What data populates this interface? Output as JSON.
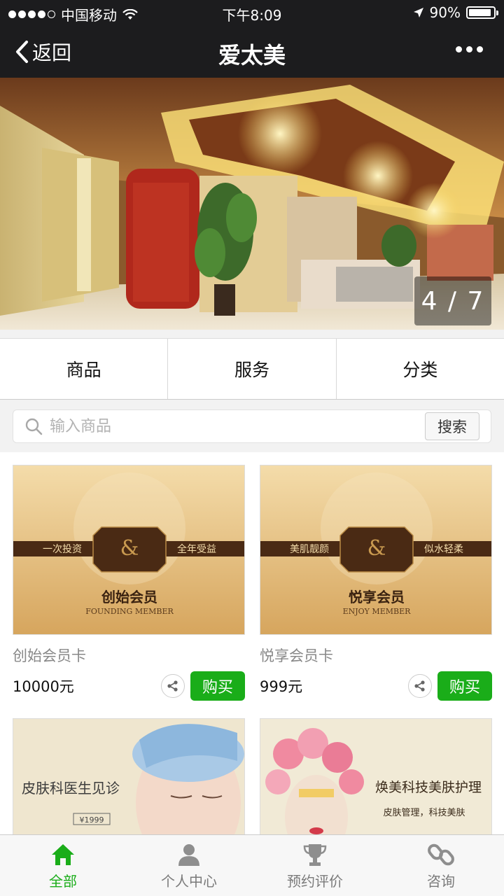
{
  "status": {
    "carrier": "中国移动",
    "time": "下午8:09",
    "battery_text": "90%",
    "battery_level": 0.9
  },
  "nav": {
    "back_label": "返回",
    "title": "爱太美"
  },
  "banner": {
    "counter": "4 / 7"
  },
  "tabs": [
    "商品",
    "服务",
    "分类"
  ],
  "search": {
    "placeholder": "输入商品",
    "button_label": "搜索"
  },
  "products": [
    {
      "name": "创始会员卡",
      "price": "10000元",
      "buy_label": "购买",
      "image": {
        "left_slogan": "一次投资",
        "right_slogan": "全年受益",
        "title": "创始会员",
        "subtitle": "FOUNDING MEMBER"
      }
    },
    {
      "name": "悦享会员卡",
      "price": "999元",
      "buy_label": "购买",
      "image": {
        "left_slogan": "美肌靓颜",
        "right_slogan": "似水轻柔",
        "title": "悦享会员",
        "subtitle": "ENJOY MEMBER"
      }
    },
    {
      "image": {
        "title": "皮肤科医生见诊",
        "price_tag": "¥1999"
      }
    },
    {
      "image": {
        "title": "焕美科技美肤护理",
        "subtitle": "皮肤管理，科技美肤"
      }
    }
  ],
  "tabbar": [
    {
      "label": "全部",
      "icon": "home-icon",
      "active": true
    },
    {
      "label": "个人中心",
      "icon": "person-icon",
      "active": false
    },
    {
      "label": "预约评价",
      "icon": "trophy-icon",
      "active": false
    },
    {
      "label": "咨询",
      "icon": "link-icon",
      "active": false
    }
  ],
  "colors": {
    "accent": "#1aad19",
    "nav_bg": "#1c1c1e"
  }
}
